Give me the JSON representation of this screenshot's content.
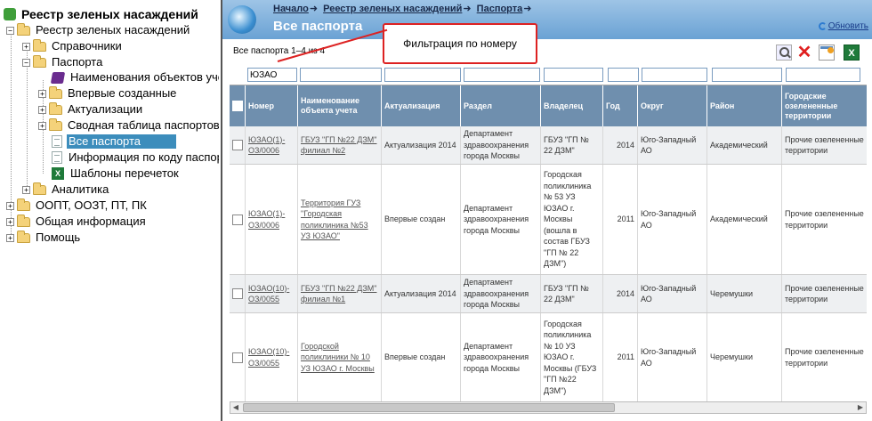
{
  "tree": {
    "root": "Реестр зеленых насаждений",
    "items": [
      {
        "label": "Реестр зеленых насаждений",
        "toggle": "−"
      },
      {
        "label": "Справочники",
        "toggle": "+"
      },
      {
        "label": "Паспорта",
        "toggle": "−"
      },
      {
        "label": "Наименования объектов учета"
      },
      {
        "label": "Впервые созданные",
        "toggle": "+"
      },
      {
        "label": "Актуализации",
        "toggle": "+"
      },
      {
        "label": "Сводная таблица паспортов",
        "toggle": "+"
      },
      {
        "label": "Все паспорта"
      },
      {
        "label": "Информация по коду паспорта"
      },
      {
        "label": "Шаблоны перечеток"
      },
      {
        "label": "Аналитика",
        "toggle": "+"
      },
      {
        "label": "ООПТ, ООЗТ, ПТ, ПК",
        "toggle": "+"
      },
      {
        "label": "Общая информация",
        "toggle": "+"
      },
      {
        "label": "Помощь",
        "toggle": "+"
      }
    ]
  },
  "header": {
    "breadcrumbs": [
      "Начало",
      "Реестр зеленых насаждений",
      "Паспорта"
    ],
    "arrow": "➜",
    "title": "Все паспорта",
    "refresh": "Обновить"
  },
  "toolbar": {
    "count_text": "Все паспорта 1–4 из 4",
    "excel_label": "X",
    "clear_label": "✕"
  },
  "callout": "Фильтрация по номеру",
  "filter": {
    "number_value": "ЮЗАО"
  },
  "table": {
    "columns": [
      "Номер",
      "Наименование объекта учета",
      "Актуализация",
      "Раздел",
      "Владелец",
      "Год",
      "Округ",
      "Район",
      "Городские озелененные территории"
    ],
    "rows": [
      {
        "number": "ЮЗАО(1)-ОЗ/0006",
        "name": "ГБУЗ \"ГП №22 ДЗМ\" филиал №2",
        "actualization": "Актуализация 2014",
        "section": "Департамент здравоохранения города Москвы",
        "owner": "ГБУЗ \"ГП № 22 ДЗМ\"",
        "year": "2014",
        "district": "Юго-Западный АО",
        "area": "Академический",
        "territory": "Прочие озелененные территории"
      },
      {
        "number": "ЮЗАО(1)-ОЗ/0006",
        "name": "Территория ГУЗ \"Городская поликлиника №53 УЗ ЮЗАО\"",
        "actualization": "Впервые создан",
        "section": "Департамент здравоохранения города Москвы",
        "owner": "Городская поликлиника № 53 УЗ ЮЗАО г. Москвы (вошла в состав ГБУЗ \"ГП № 22 ДЗМ\")",
        "year": "2011",
        "district": "Юго-Западный АО",
        "area": "Академический",
        "territory": "Прочие озелененные территории"
      },
      {
        "number": "ЮЗАО(10)-ОЗ/0055",
        "name": "ГБУЗ \"ГП №22 ДЗМ\" филиал №1",
        "actualization": "Актуализация 2014",
        "section": "Департамент здравоохранения города Москвы",
        "owner": "ГБУЗ \"ГП № 22 ДЗМ\"",
        "year": "2014",
        "district": "Юго-Западный АО",
        "area": "Черемушки",
        "territory": "Прочие озелененные территории"
      },
      {
        "number": "ЮЗАО(10)-ОЗ/0055",
        "name": "Городской поликлиники № 10 УЗ ЮЗАО г. Москвы",
        "actualization": "Впервые создан",
        "section": "Департамент здравоохранения города Москвы",
        "owner": "Городская поликлиника № 10 УЗ ЮЗАО г. Москвы (ГБУЗ \"ГП №22 ДЗМ\")",
        "year": "2011",
        "district": "Юго-Западный АО",
        "area": "Черемушки",
        "territory": "Прочие озелененные территории"
      }
    ]
  }
}
